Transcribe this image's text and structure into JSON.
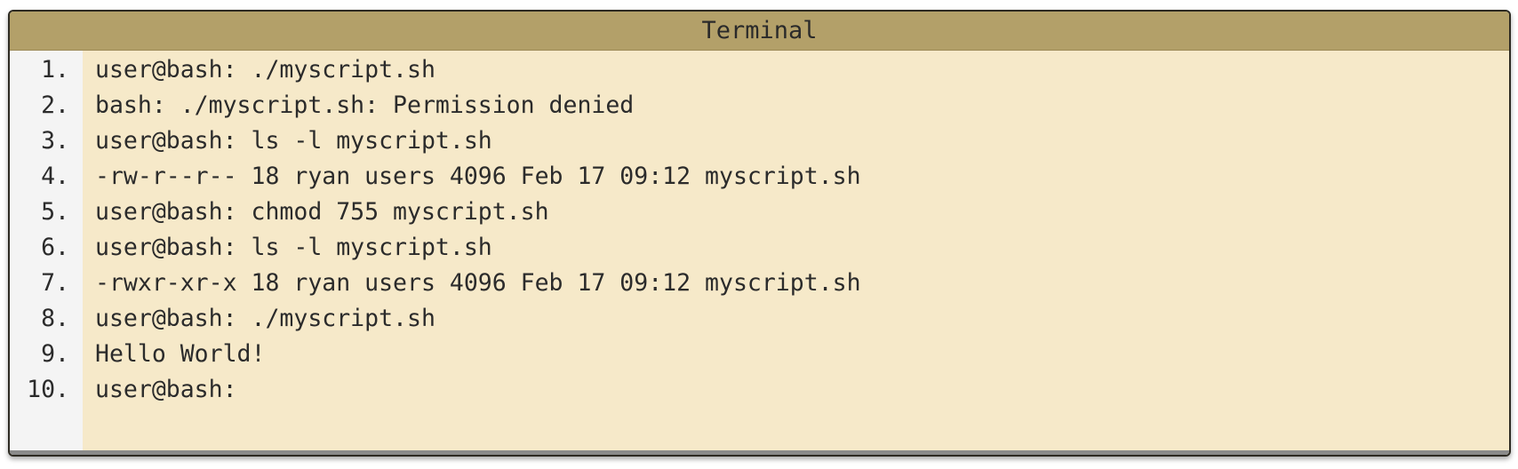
{
  "window": {
    "title": "Terminal"
  },
  "terminal": {
    "lines": [
      {
        "number": "1.",
        "text": "user@bash: ./myscript.sh"
      },
      {
        "number": "2.",
        "text": "bash: ./myscript.sh: Permission denied"
      },
      {
        "number": "3.",
        "text": "user@bash: ls -l myscript.sh"
      },
      {
        "number": "4.",
        "text": "-rw-r--r-- 18 ryan users 4096 Feb 17 09:12 myscript.sh"
      },
      {
        "number": "5.",
        "text": "user@bash: chmod 755 myscript.sh"
      },
      {
        "number": "6.",
        "text": "user@bash: ls -l myscript.sh"
      },
      {
        "number": "7.",
        "text": "-rwxr-xr-x 18 ryan users 4096 Feb 17 09:12 myscript.sh"
      },
      {
        "number": "8.",
        "text": "user@bash: ./myscript.sh"
      },
      {
        "number": "9.",
        "text": "Hello World!"
      },
      {
        "number": "10.",
        "text": "user@bash:"
      }
    ]
  },
  "colors": {
    "titlebar": "#b3a069",
    "content_background": "#f6e9c9",
    "gutter_background": "#f4f4f4",
    "text": "#2b2b2b"
  }
}
